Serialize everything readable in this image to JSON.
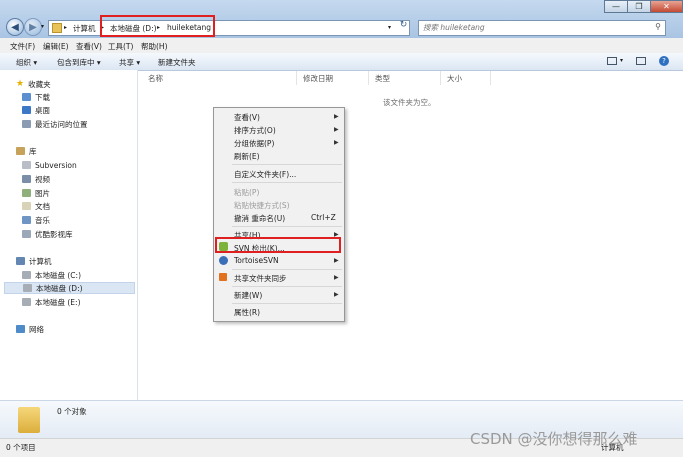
{
  "window": {
    "breadcrumb": [
      "计算机",
      "本地磁盘 (D:)",
      "huileketang"
    ],
    "search_placeholder": "搜索 huileketang",
    "controls": [
      "—",
      "❐",
      "✕"
    ]
  },
  "menu": [
    "文件(F)",
    "编辑(E)",
    "查看(V)",
    "工具(T)",
    "帮助(H)"
  ],
  "toolbar": [
    "组织 ▾",
    "包含到库中 ▾",
    "共享 ▾",
    "新建文件夹"
  ],
  "nav": {
    "favorites": {
      "title": "收藏夹",
      "items": [
        "下载",
        "桌面",
        "最近访问的位置"
      ]
    },
    "libraries": {
      "title": "库",
      "items": [
        "Subversion",
        "视频",
        "图片",
        "文档",
        "音乐",
        "优酷影视库"
      ]
    },
    "computer": {
      "title": "计算机",
      "items": [
        "本地磁盘 (C:)",
        "本地磁盘 (D:)",
        "本地磁盘 (E:)"
      ]
    },
    "network": {
      "title": "网络"
    }
  },
  "columns": [
    "名称",
    "修改日期",
    "类型",
    "大小"
  ],
  "empty_message": "该文件夹为空。",
  "context_menu": {
    "view": "查看(V)",
    "sort": "排序方式(O)",
    "group": "分组依据(P)",
    "refresh": "刷新(E)",
    "customize": "自定义文件夹(F)...",
    "paste": "粘贴(P)",
    "paste_shortcut": "粘贴快捷方式(S)",
    "undo": "撤消 重命名(U)",
    "undo_shortcut": "Ctrl+Z",
    "share": "共享(H)",
    "svn_checkout": "SVN 检出(K)...",
    "tortoise": "TortoiseSVN",
    "sync": "共享文件夹同步",
    "new": "新建(W)",
    "properties": "属性(R)"
  },
  "details": {
    "count": "0 个对象"
  },
  "status": {
    "left": "0 个项目",
    "right": "计算机"
  },
  "watermark": "CSDN @没你想得那么难",
  "colors": {
    "highlight": "#e02020",
    "title_bg": "#b7cfe9"
  }
}
